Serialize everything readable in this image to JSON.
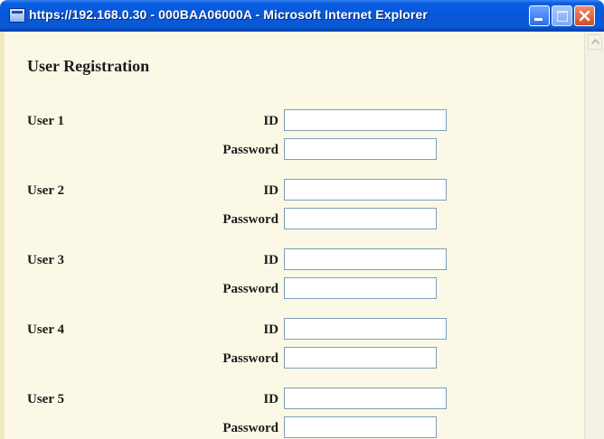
{
  "window": {
    "title": "https://192.168.0.30 - 000BAA06000A - Microsoft Internet Explorer",
    "controls": [
      "minimize-icon",
      "maximize-icon",
      "close-icon"
    ],
    "colors": {
      "titlebar": "#0757d8",
      "page_background": "#fbf9e6",
      "frame": "#eee9c0",
      "close_button": "#d64d21"
    }
  },
  "page": {
    "title": "User Registration",
    "id_label": "ID",
    "password_label": "Password",
    "users": [
      {
        "label": "User 1",
        "id": "",
        "password": ""
      },
      {
        "label": "User 2",
        "id": "",
        "password": ""
      },
      {
        "label": "User 3",
        "id": "",
        "password": ""
      },
      {
        "label": "User 4",
        "id": "",
        "password": ""
      },
      {
        "label": "User 5",
        "id": "",
        "password": ""
      }
    ]
  },
  "scrollbar": {
    "up_icon": "scroll-up-arrow-icon"
  }
}
